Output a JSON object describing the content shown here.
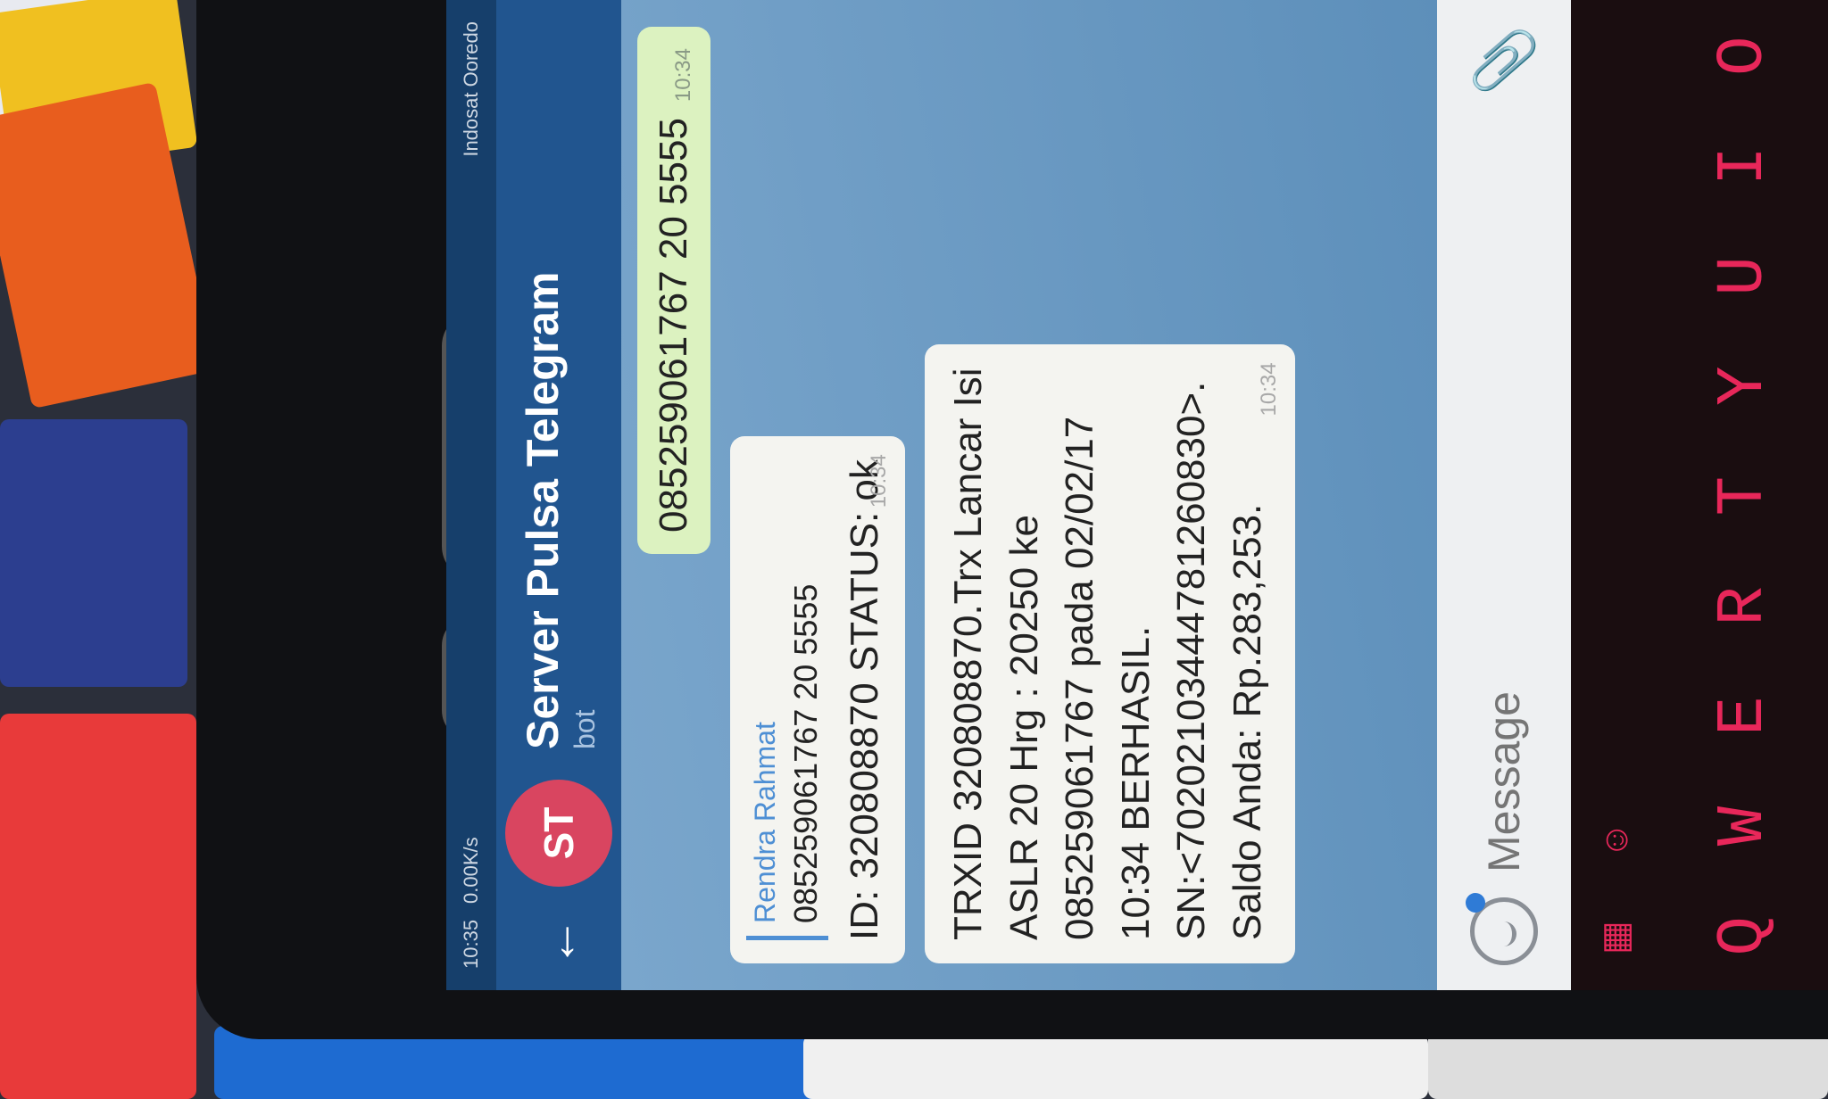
{
  "status_bar": {
    "time": "10:35",
    "net_speed": "0.00K/s",
    "notice": "Indosat Ooredo"
  },
  "header": {
    "back_icon": "back-arrow-icon",
    "avatar_initials": "ST",
    "title": "Server Pulsa Telegram",
    "subtitle": "bot"
  },
  "messages": {
    "outgoing": {
      "text": "085259061767 20 5555",
      "time": "10:34"
    },
    "reply_1": {
      "quote_name": "Rendra Rahmat",
      "quote_text": "085259061767 20 5555",
      "text": "ID: 320808870 STATUS: ok",
      "time": "10:34"
    },
    "reply_2": {
      "lines": [
        "TRXID 320808870.Trx Lancar Isi",
        "ASLR 20 Hrg : 20250 ke",
        "085259061767 pada 02/02/17",
        "10:34 BERHASIL.",
        "SN:<70202103444781260830>.",
        "Saldo Anda: Rp.283,253."
      ],
      "time": "10:34"
    }
  },
  "input": {
    "placeholder": "Message",
    "emoji_icon": "emoji-icon",
    "attach_icon": "paperclip-icon"
  },
  "keyboard": {
    "keys": [
      "Q",
      "W",
      "E",
      "R",
      "T",
      "Y",
      "U",
      "I",
      "O"
    ]
  },
  "colors": {
    "header": "#21558f",
    "avatar": "#d94560",
    "outgoing_bubble": "#dcf2c0",
    "keyboard_text": "#e8275a"
  }
}
